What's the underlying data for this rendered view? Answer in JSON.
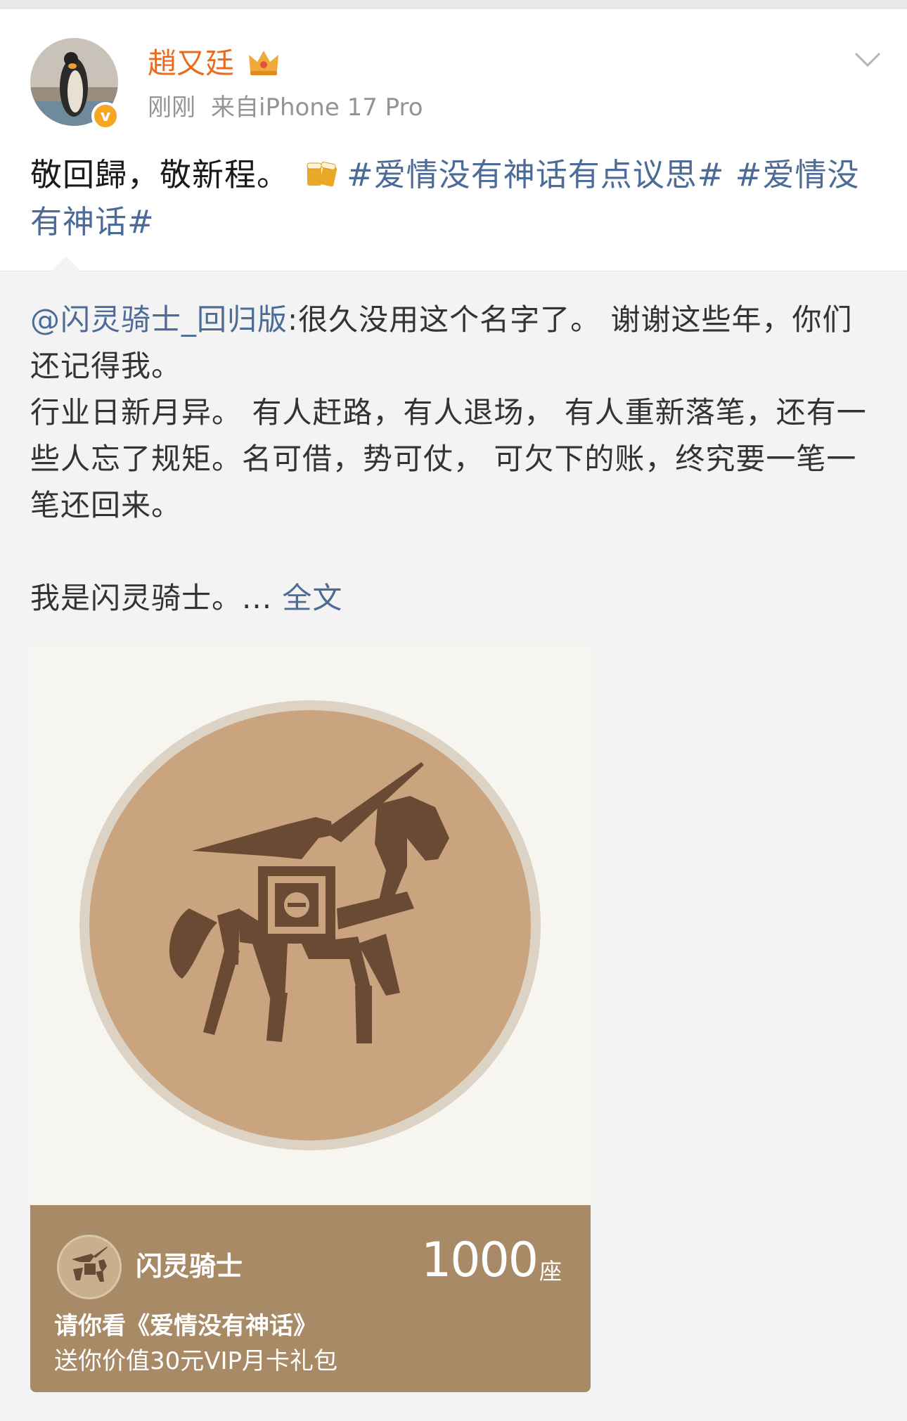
{
  "post": {
    "username": "趙又廷",
    "time": "刚刚",
    "source": "来自iPhone 17 Pro",
    "text_prefix": "敬回歸，敬新程。",
    "topic1": "#爱情没有神话有点议思#",
    "topic2": "#爱情没有神话#"
  },
  "repost": {
    "mention": "@闪灵骑士_回归版",
    "text1": ":很久没用这个名字了。 谢谢这些年，你们还记得我。",
    "text2": "行业日新月异。 有人赶路，有人退场， 有人重新落笔，还有一些人忘了规矩。名可借，势可仗， 可欠下的账，终究要一笔一笔还回来。",
    "text3": "我是闪灵骑士。... ",
    "full_text_label": "全文"
  },
  "ticket": {
    "name": "闪灵骑士",
    "count": "1000",
    "unit": "座",
    "line1": "请你看《爱情没有神话》",
    "line2": "送你价值30元VIP月卡礼包"
  },
  "colors": {
    "username": "#e86b1f",
    "topic": "#4c6b96",
    "ticket_bg": "#a88a66",
    "coin": "#c9a47f",
    "emblem": "#6b4a35"
  }
}
